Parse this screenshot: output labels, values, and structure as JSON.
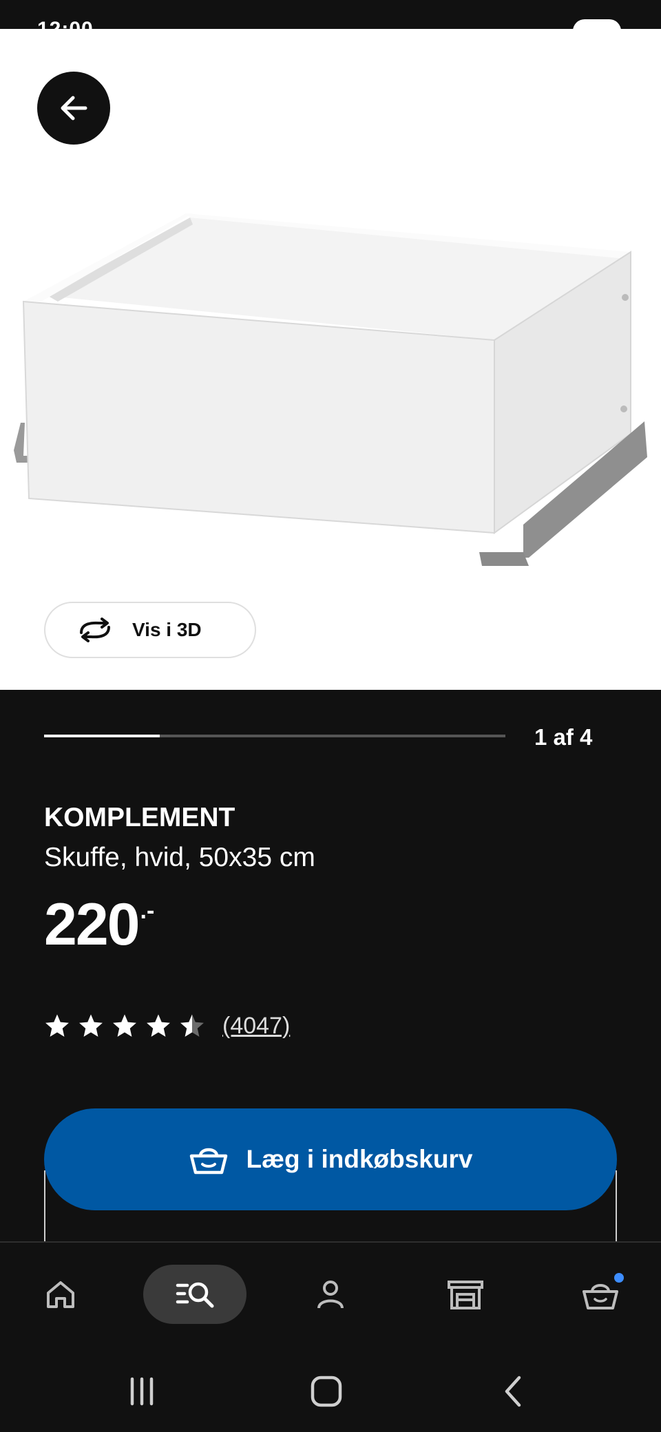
{
  "status_bar": {
    "time": "12:00"
  },
  "gallery": {
    "view_3d_label": "Vis i 3D",
    "counter": "1 af 4",
    "progress": 0.25
  },
  "product": {
    "name": "KOMPLEMENT",
    "description": "Skuffe, hvid, 50x35 cm",
    "price": "220",
    "price_suffix": ".-",
    "rating": 4.5,
    "review_count": "(4047)"
  },
  "cart_button": {
    "label": "Læg i indkøbskurv"
  },
  "bottom_nav": {
    "items": [
      "home-icon",
      "search-icon",
      "profile-icon",
      "store-icon",
      "cart-icon"
    ],
    "active_index": 1,
    "cart_badge_color": "#3d8dff"
  },
  "colors": {
    "background": "#111111",
    "accent_blue": "#0058a3",
    "white": "#ffffff"
  }
}
